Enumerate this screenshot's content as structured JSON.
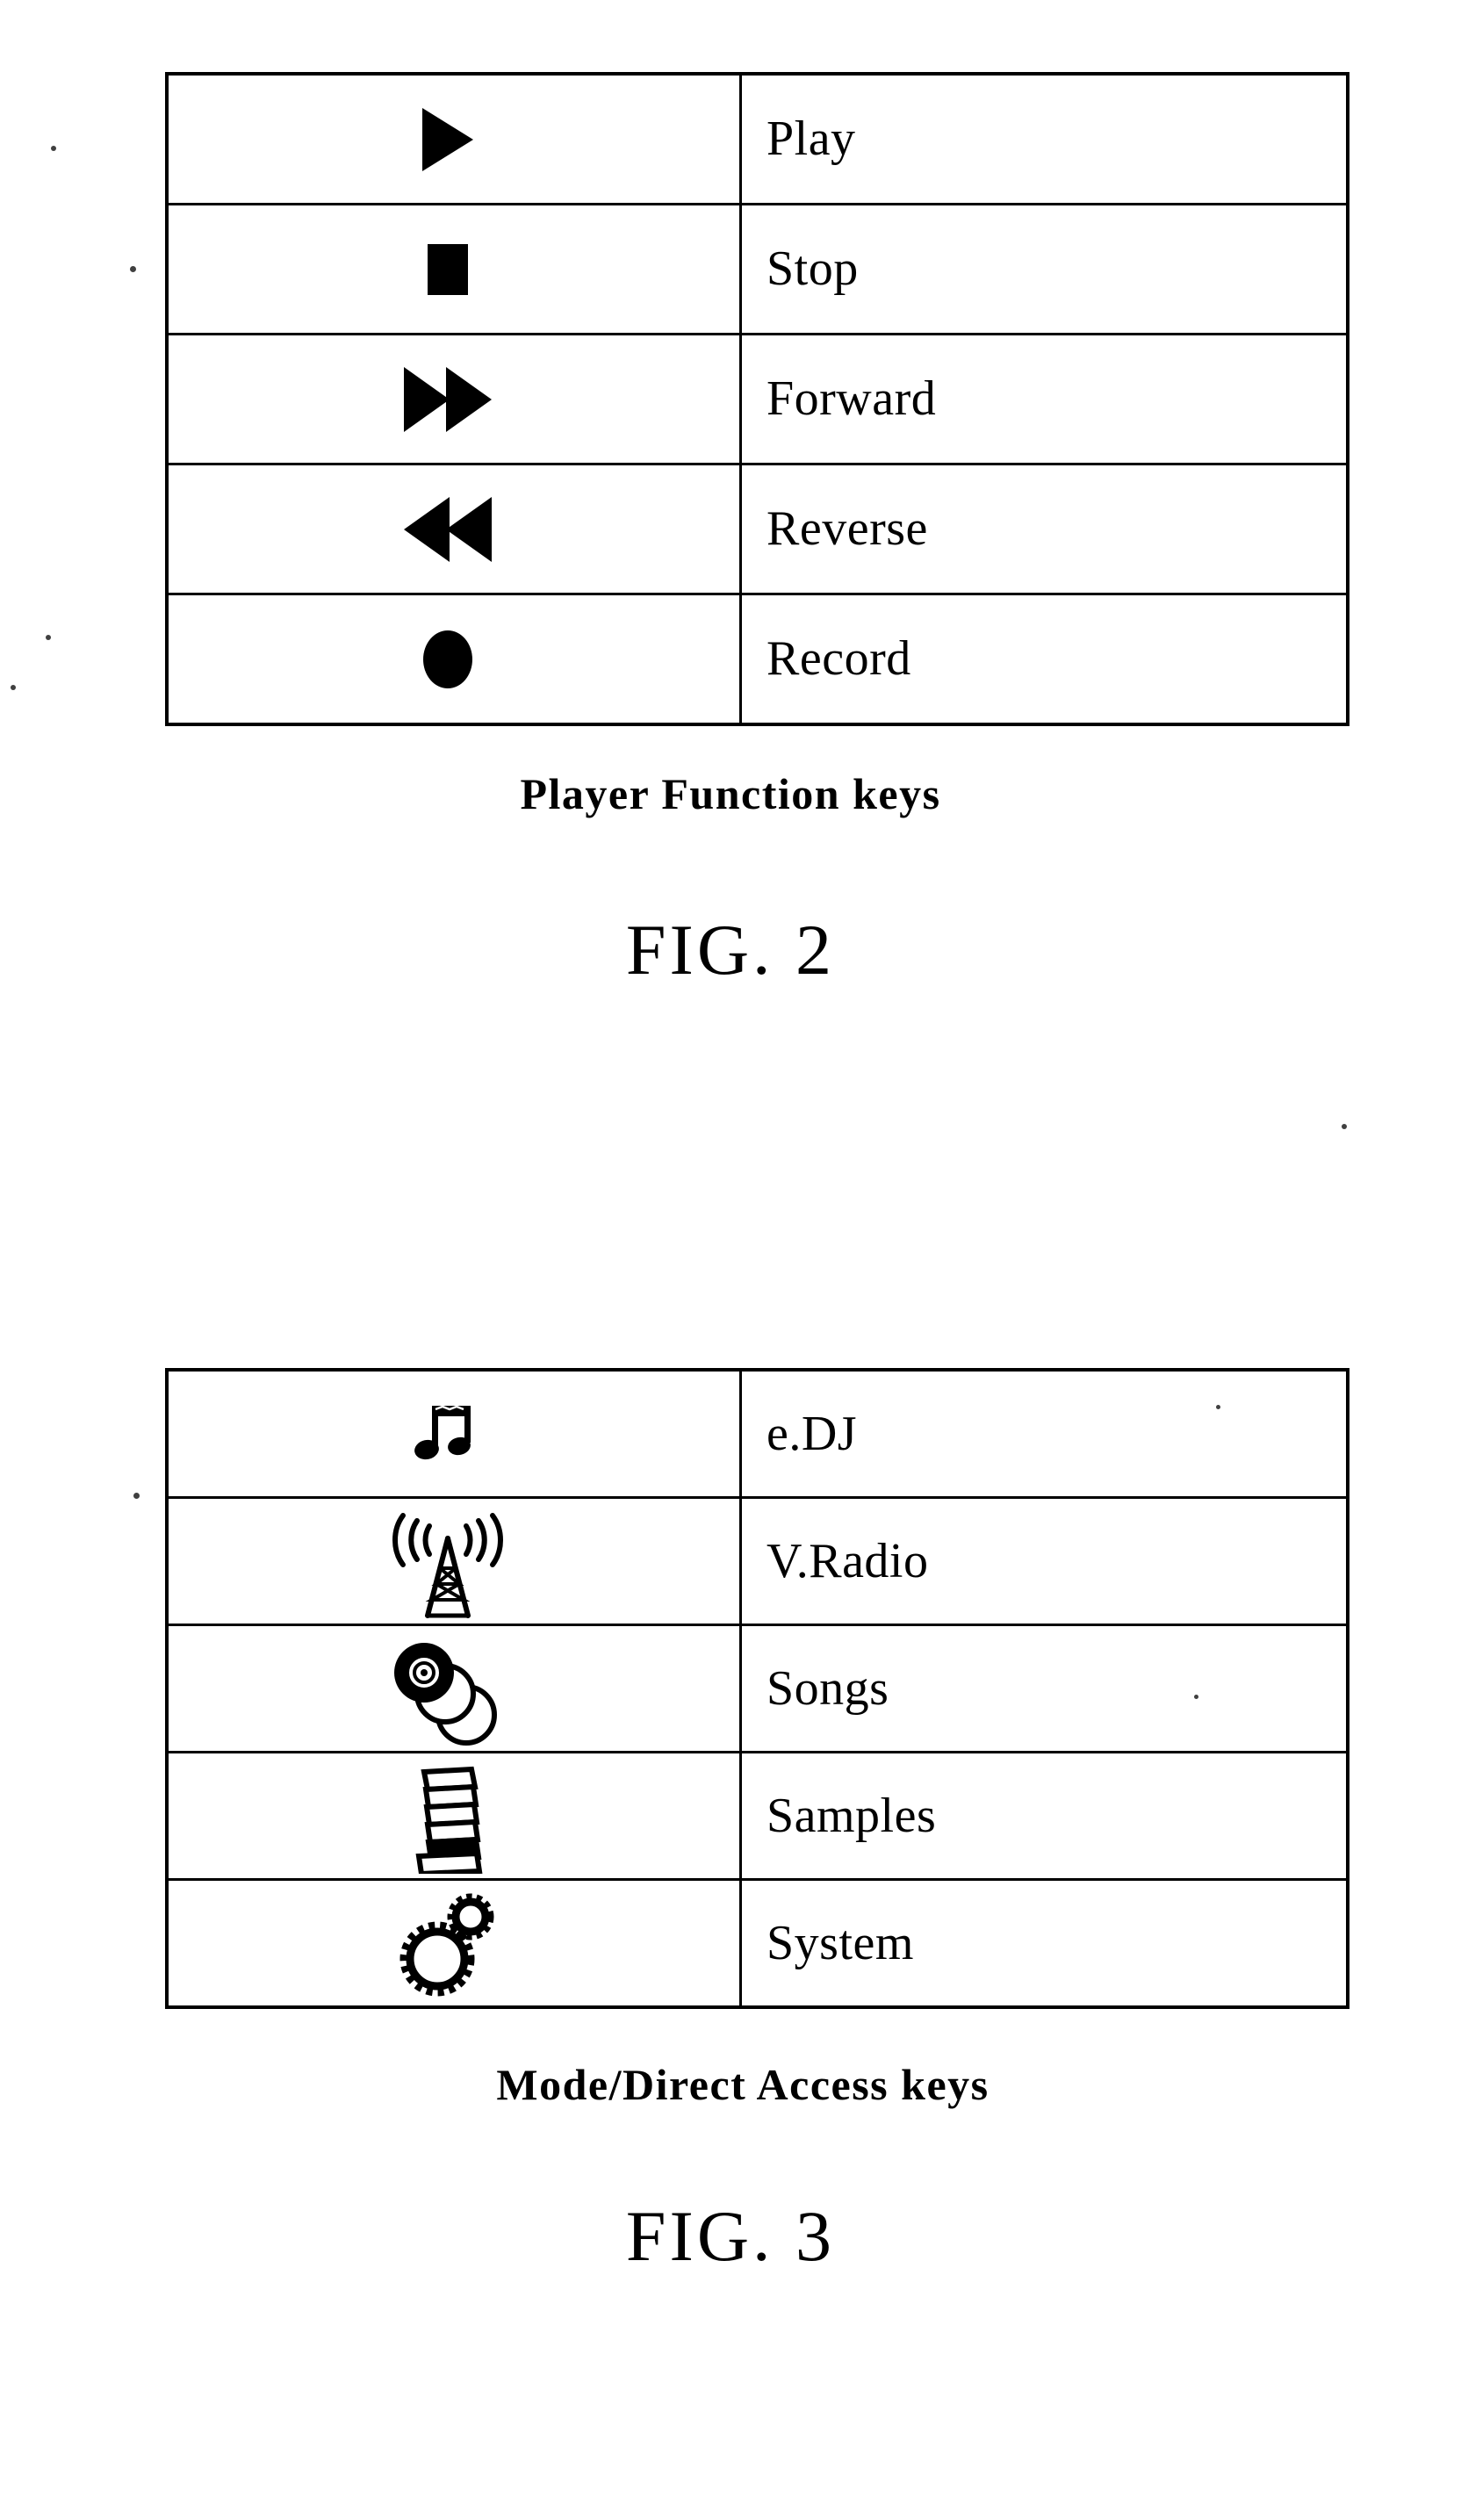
{
  "figures": [
    {
      "id": "fig2",
      "caption": "Player Function keys",
      "number": "FIG. 2",
      "rows": [
        {
          "icon": "play-icon",
          "label": "Play"
        },
        {
          "icon": "stop-icon",
          "label": "Stop"
        },
        {
          "icon": "forward-icon",
          "label": "Forward"
        },
        {
          "icon": "reverse-icon",
          "label": "Reverse"
        },
        {
          "icon": "record-icon",
          "label": "Record"
        }
      ]
    },
    {
      "id": "fig3",
      "caption": "Mode/Direct Access keys",
      "number": "FIG. 3",
      "rows": [
        {
          "icon": "music-note-icon",
          "label": "e.DJ"
        },
        {
          "icon": "radio-tower-icon",
          "label": "V.Radio"
        },
        {
          "icon": "compact-discs-icon",
          "label": "Songs"
        },
        {
          "icon": "sample-stack-icon",
          "label": "Samples"
        },
        {
          "icon": "gears-icon",
          "label": "System"
        }
      ]
    }
  ],
  "colors": {
    "ink": "#000000",
    "paper": "#ffffff"
  }
}
